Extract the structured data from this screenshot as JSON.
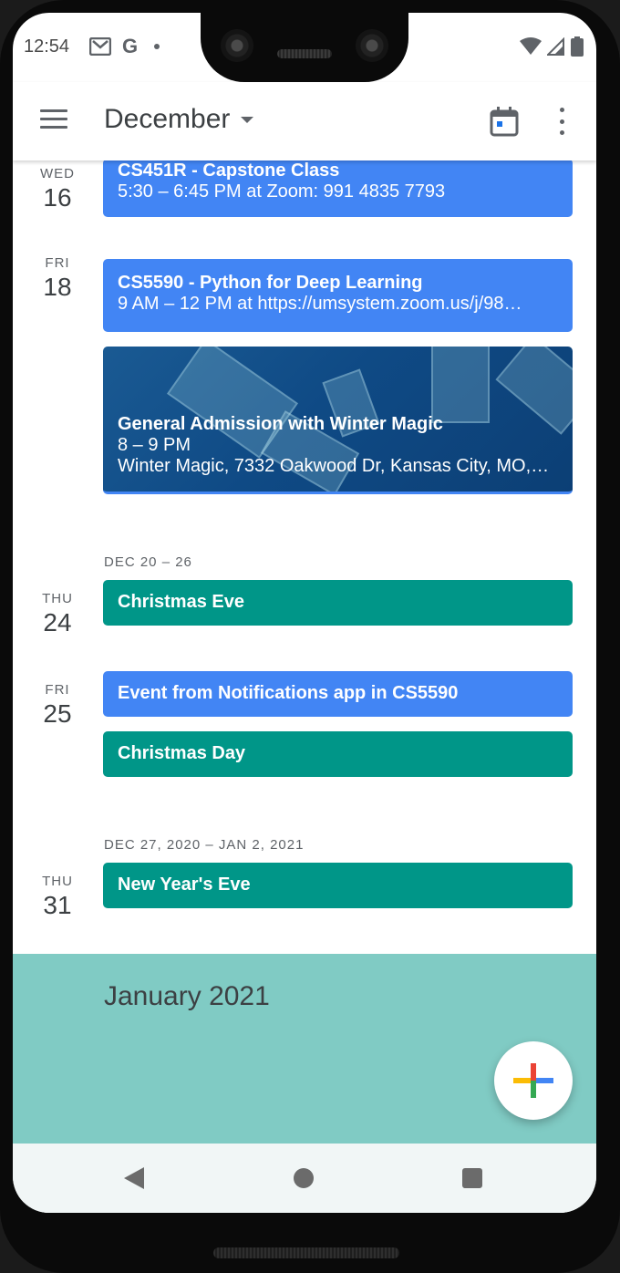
{
  "status_bar": {
    "time": "12:54",
    "notification_icons": [
      "gmail-icon",
      "google-icon",
      "dot-icon"
    ],
    "google_glyph": "G",
    "right_icons": [
      "wifi-icon",
      "cell-signal-icon",
      "battery-icon"
    ]
  },
  "app_bar": {
    "month": "December",
    "icons": [
      "menu-icon",
      "today-calendar-icon",
      "more-vert-icon"
    ]
  },
  "days": [
    {
      "dow": "WED",
      "dom": "16"
    },
    {
      "dow": "FRI",
      "dom": "18"
    },
    {
      "dow": "THU",
      "dom": "24"
    },
    {
      "dow": "FRI",
      "dom": "25"
    },
    {
      "dow": "THU",
      "dom": "31"
    }
  ],
  "week_labels": [
    "DEC 20 – 26",
    "DEC 27, 2020 – JAN 2, 2021"
  ],
  "events": [
    {
      "title": "CS451R - Capstone Class",
      "line1": "5:30 – 6:45 PM at Zoom: 991 4835 7793",
      "color": "#4285f4"
    },
    {
      "title": "CS5590 - Python for Deep Learning",
      "line1": "9 AM – 12 PM at https://umsystem.zoom.us/j/98…",
      "color": "#4285f4"
    },
    {
      "title": "General Admission with Winter Magic",
      "line1": "8 – 9 PM",
      "line2": "Winter Magic, 7332 Oakwood Dr, Kansas City, MO,…",
      "color": "#0f4a85"
    },
    {
      "title": "Christmas Eve",
      "color": "#009688"
    },
    {
      "title": "Event from Notifications app in CS5590",
      "color": "#4285f4"
    },
    {
      "title": "Christmas Day",
      "color": "#009688"
    },
    {
      "title": "New Year's Eve",
      "color": "#009688"
    }
  ],
  "month_banner": {
    "title": "January 2021",
    "color": "#80cbc4"
  },
  "fab": {
    "icon": "add-plus-icon"
  },
  "nav_bar": {
    "icons": [
      "back-icon",
      "home-icon",
      "recents-icon"
    ]
  }
}
